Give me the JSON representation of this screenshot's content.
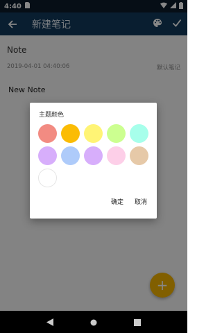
{
  "status_bar": {
    "time": "4:40"
  },
  "app_bar": {
    "title": "新建笔记"
  },
  "note": {
    "title": "Note",
    "date": "2019-04-01 04:40:06",
    "category": "默认笔记",
    "body": "New Note"
  },
  "dialog": {
    "title": "主题颜色",
    "colors": [
      "#f28b82",
      "#fbbc04",
      "#fff475",
      "#ccff90",
      "#a7ffeb",
      "#d7aefb",
      "#aecbfa",
      "#d7aefb",
      "#fdcfe8",
      "#e6c9a8",
      "#ffffff"
    ],
    "confirm_label": "确定",
    "cancel_label": "取消"
  },
  "fab": {
    "icon": "+"
  }
}
